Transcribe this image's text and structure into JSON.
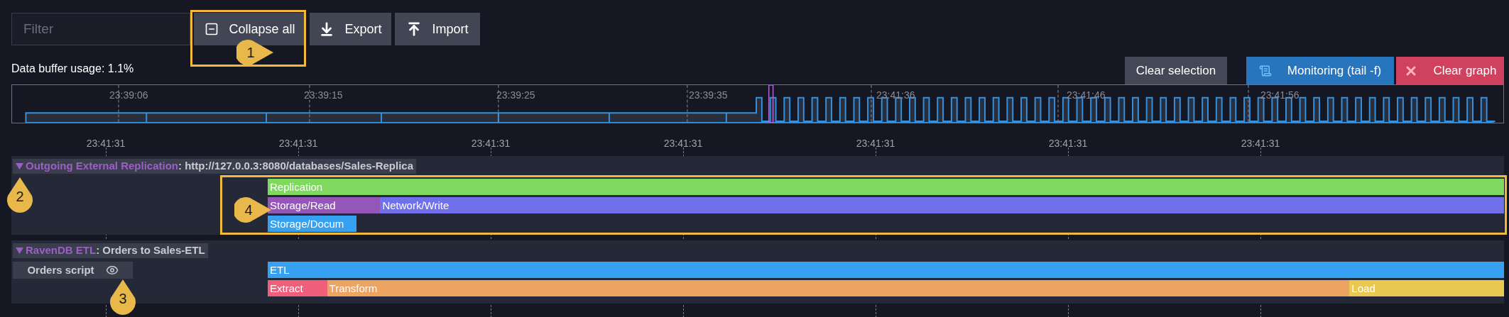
{
  "filter": {
    "placeholder": "Filter"
  },
  "toolbar": [
    {
      "kind": "collapse",
      "label": "Collapse all"
    },
    {
      "kind": "export",
      "label": "Export"
    },
    {
      "kind": "import",
      "label": "Import"
    }
  ],
  "buffer_usage": "Data buffer usage: 1.1%",
  "actions": [
    {
      "kind": "clear-selection",
      "label": "Clear selection"
    },
    {
      "kind": "monitoring",
      "label": "Monitoring (tail -f)"
    },
    {
      "kind": "clear-graph",
      "label": "Clear graph"
    }
  ],
  "overview": {
    "ticks": [
      "23:39:06",
      "23:39:15",
      "23:39:25",
      "23:39:35",
      "23:41:36",
      "23:41:46",
      "23:41:56"
    ]
  },
  "axis_labels": [
    "23:41:31",
    "23:41:31",
    "23:41:31",
    "23:41:31",
    "23:41:31",
    "23:41:31",
    "23:41:31"
  ],
  "sections": [
    {
      "type": "Outgoing External Replication",
      "name": ": http://127.0.0.3:8080/databases/Sales-Replica",
      "expanded": true,
      "tracks": [
        [
          {
            "label": "Replication",
            "color": "#7ed95e"
          }
        ],
        [
          {
            "label": "Storage/Read",
            "color": "#9457b8"
          },
          {
            "label": "Network/Write",
            "color": "#7170eb"
          }
        ],
        [
          {
            "label": "Storage/Docum",
            "color": "#35a1f0"
          }
        ]
      ]
    },
    {
      "type": "RavenDB ETL",
      "name": ": Orders to Sales-ETL",
      "expanded": true,
      "script": {
        "label": "Orders script"
      },
      "tracks": [
        [
          {
            "label": "ETL",
            "color": "#35a1f0"
          }
        ],
        [
          {
            "label": "Extract",
            "color": "#ef5f7a"
          },
          {
            "label": "Transform",
            "color": "#eda462"
          },
          {
            "label": "Load",
            "color": "#e9c952"
          }
        ]
      ]
    }
  ],
  "callouts": [
    {
      "label": "1",
      "kind": "right"
    },
    {
      "label": "2",
      "kind": "up"
    },
    {
      "label": "3",
      "kind": "up"
    },
    {
      "label": "4",
      "kind": "right"
    }
  ]
}
